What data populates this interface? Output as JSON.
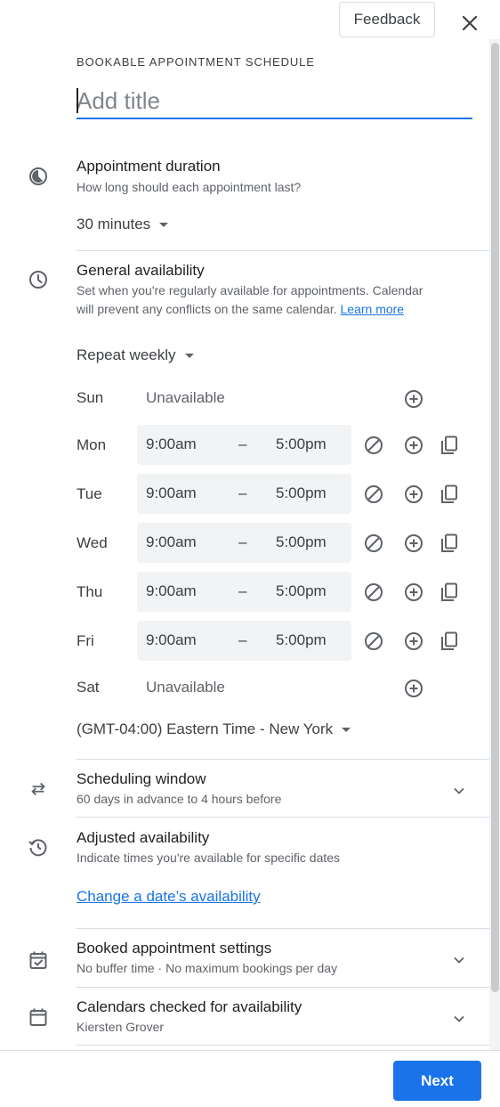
{
  "header": {
    "feedback_label": "Feedback",
    "kind_label": "BOOKABLE APPOINTMENT SCHEDULE",
    "title_value": "",
    "title_placeholder": "Add title"
  },
  "duration": {
    "title": "Appointment duration",
    "subtitle": "How long should each appointment last?",
    "value": "30 minutes"
  },
  "availability": {
    "title": "General availability",
    "subtitle_line1": "Set when you're regularly available for appointments. Calendar",
    "subtitle_line2": "will prevent any conflicts on the same calendar.",
    "learn_more": "Learn more",
    "repeat": "Repeat weekly",
    "days": [
      {
        "day": "Sun",
        "unavailable": "Unavailable"
      },
      {
        "day": "Mon",
        "start": "9:00am",
        "dash": "–",
        "end": "5:00pm"
      },
      {
        "day": "Tue",
        "start": "9:00am",
        "dash": "–",
        "end": "5:00pm"
      },
      {
        "day": "Wed",
        "start": "9:00am",
        "dash": "–",
        "end": "5:00pm"
      },
      {
        "day": "Thu",
        "start": "9:00am",
        "dash": "–",
        "end": "5:00pm"
      },
      {
        "day": "Fri",
        "start": "9:00am",
        "dash": "–",
        "end": "5:00pm"
      },
      {
        "day": "Sat",
        "unavailable": "Unavailable"
      }
    ],
    "timezone": "(GMT-04:00) Eastern Time - New York"
  },
  "scheduling_window": {
    "title": "Scheduling window",
    "subtitle": "60 days in advance to 4 hours before"
  },
  "adjusted": {
    "title": "Adjusted availability",
    "subtitle": "Indicate times you're available for specific dates",
    "link": "Change a date’s availability"
  },
  "booked": {
    "title": "Booked appointment settings",
    "subtitle": "No buffer time · No maximum bookings per day"
  },
  "calendars": {
    "title": "Calendars checked for availability",
    "subtitle": "Kiersten Grover"
  },
  "footer": {
    "next_label": "Next"
  },
  "colors": {
    "accent": "#1a73e8",
    "icon": "#5f6368",
    "divider": "#dadce0"
  }
}
